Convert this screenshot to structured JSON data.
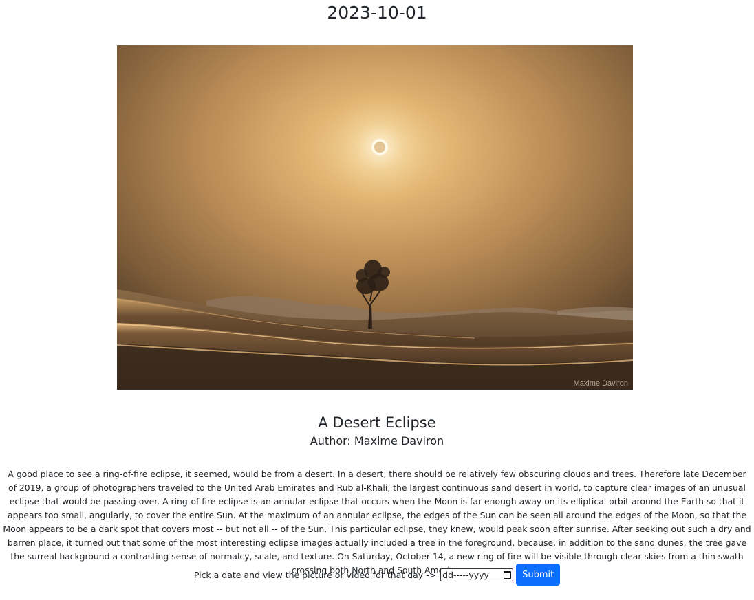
{
  "header": {
    "date": "2023-10-01"
  },
  "media": {
    "alt": "A Desert Eclipse",
    "credit": "Maxime Daviron"
  },
  "article": {
    "title": "A Desert Eclipse",
    "author": "Author: Maxime Daviron",
    "explanation": "A good place to see a ring-of-fire eclipse, it seemed, would be from a desert. In a desert, there should be relatively few obscuring clouds and trees. Therefore late December of 2019, a group of photographers traveled to the United Arab Emirates and Rub al-Khali, the largest continuous sand desert in world, to capture clear images of an unusual eclipse that would be passing over. A ring-of-fire eclipse is an annular eclipse that occurs when the Moon is far enough away on its elliptical orbit around the Earth so that it appears too small, angularly, to cover the entire Sun. At the maximum of an annular eclipse, the edges of the Sun can be seen all around the edges of the Moon, so that the Moon appears to be a dark spot that covers most -- but not all -- of the Sun. This particular eclipse, they knew, would peak soon after sunrise. After seeking out such a dry and barren place, it turned out that some of the most interesting eclipse images actually included a tree in the foreground, because, in addition to the sand dunes, the tree gave the surreal background a contrasting sense of normalcy, scale, and texture. On Saturday, October 14, a new ring of fire will be visible through clear skies from a thin swath crossing both North and South America."
  },
  "form": {
    "prompt": "Pick a date and view the picture or video for that day ->",
    "date_placeholder": "dd-----yyyy",
    "submit_label": "Submit"
  }
}
